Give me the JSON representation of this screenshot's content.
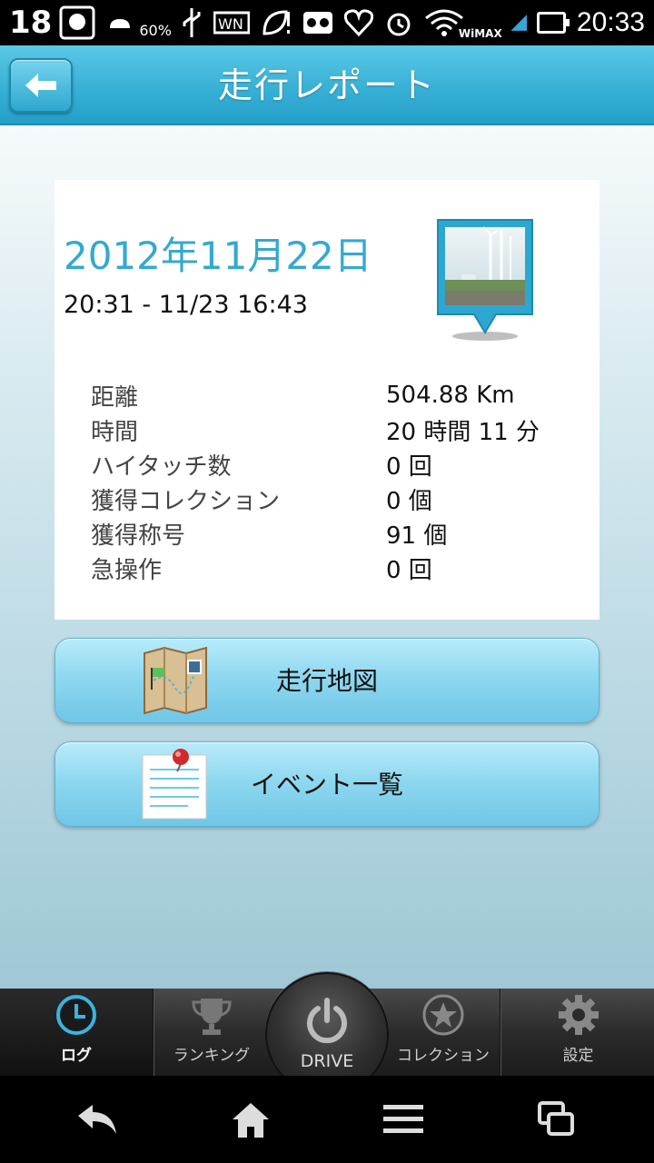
{
  "status_bar": {
    "notification_count": "18",
    "battery_small": "60%",
    "network": "WiMAX",
    "time": "20:33"
  },
  "header": {
    "title": "走行レポート",
    "back_icon": "back-arrow-icon"
  },
  "report": {
    "date": "2012年11月22日",
    "time_range": "20:31 - 11/23 16:43",
    "stats": [
      {
        "label": "距離",
        "value": "504.88 Km"
      },
      {
        "label": "時間",
        "value": "20 時間 11 分"
      },
      {
        "label": "ハイタッチ数",
        "value": "0 回"
      },
      {
        "label": "獲得コレクション",
        "value": "0 個"
      },
      {
        "label": "獲得称号",
        "value": "91 個"
      },
      {
        "label": "急操作",
        "value": "0 回"
      }
    ]
  },
  "actions": {
    "map_label": "走行地図",
    "events_label": "イベント一覧"
  },
  "tabs": {
    "log": "ログ",
    "ranking": "ランキング",
    "drive": "DRIVE",
    "collection": "コレクション",
    "settings": "設定"
  },
  "colors": {
    "accent": "#34a9cf",
    "header": "#38b1d6",
    "button": "#8fd8f0"
  }
}
